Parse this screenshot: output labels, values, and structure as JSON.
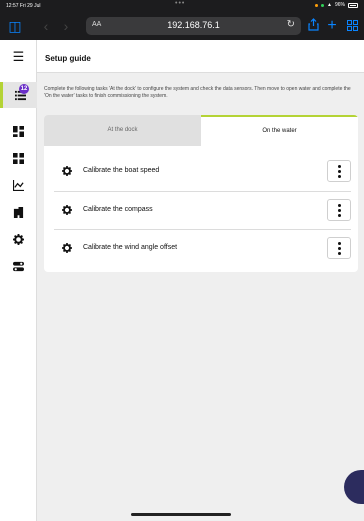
{
  "status": {
    "time": "12:57",
    "date": "Fri 29 Jul",
    "battery": "96%"
  },
  "browser": {
    "aa": "AA",
    "url": "192.168.76.1"
  },
  "sidebar": {
    "badge": "12"
  },
  "page": {
    "title": "Setup guide",
    "intro": "Complete the following tasks 'At the dock' to configure the system and check the data sensors. Then move to open water and complete the 'On the water' tasks to finish commissioning the system."
  },
  "tabs": [
    {
      "label": "At the dock",
      "active": false
    },
    {
      "label": "On the water",
      "active": true
    }
  ],
  "tasks": [
    {
      "label": "Calibrate the boat speed"
    },
    {
      "label": "Calibrate the compass"
    },
    {
      "label": "Calibrate the wind angle offset"
    }
  ],
  "colors": {
    "accent": "#b4d335",
    "badge": "#6a2fc8",
    "browser_blue": "#0a84ff"
  }
}
